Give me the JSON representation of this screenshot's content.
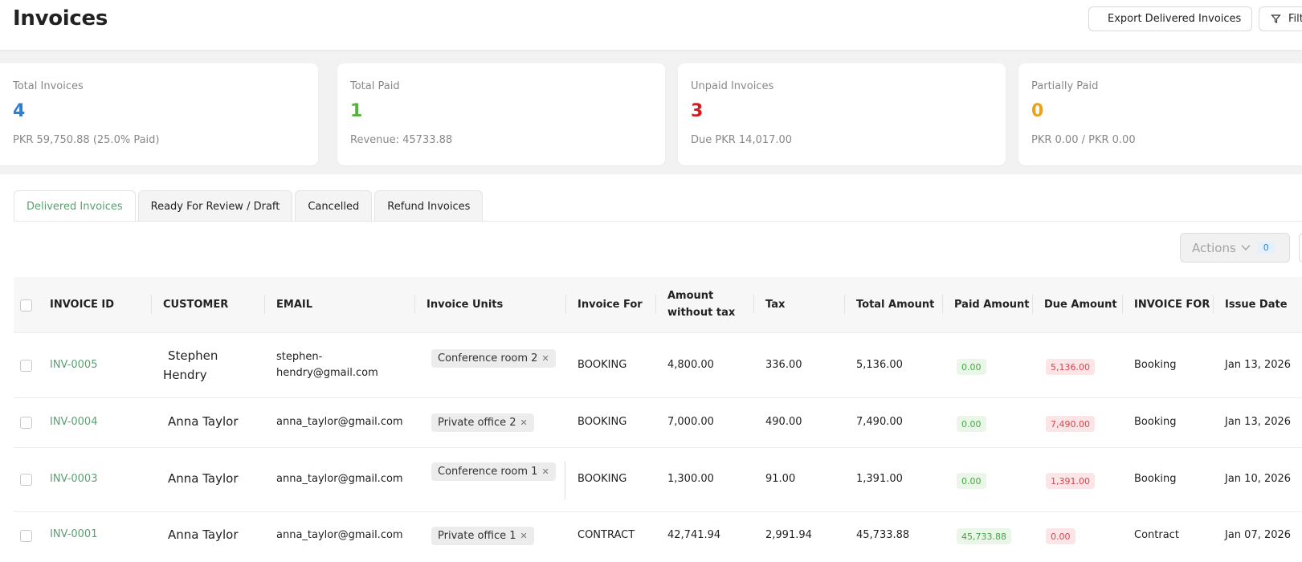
{
  "header": {
    "title": "Invoices",
    "export_label": "Export Delivered Invoices",
    "filter_label": "Filters"
  },
  "cards": [
    {
      "label": "Total Invoices",
      "value": "4",
      "sub": "PKR 59,750.88 (25.0% Paid)",
      "color": "#2b7fd6"
    },
    {
      "label": "Total Paid",
      "value": "1",
      "sub": "Revenue: 45733.88",
      "color": "#52b43a"
    },
    {
      "label": "Unpaid Invoices",
      "value": "3",
      "sub": "Due PKR 14,017.00",
      "color": "#d51b22"
    },
    {
      "label": "Partially Paid",
      "value": "0",
      "sub": "PKR 0.00 / PKR 0.00",
      "color": "#eaa21a"
    }
  ],
  "tabs": [
    {
      "label": "Delivered Invoices",
      "active": true
    },
    {
      "label": "Ready For Review / Draft",
      "active": false
    },
    {
      "label": "Cancelled",
      "active": false
    },
    {
      "label": "Refund Invoices",
      "active": false
    }
  ],
  "actions": {
    "label": "Actions",
    "count": "0"
  },
  "table": {
    "columns": {
      "invoice_id": "INVOICE ID",
      "customer": "CUSTOMER",
      "email": "EMAIL",
      "units": "Invoice Units",
      "invoice_for": "Invoice For",
      "amount_line1": "Amount",
      "amount_line2": "without tax",
      "tax": "Tax",
      "total": "Total Amount",
      "paid": "Paid Amount",
      "due": "Due Amount",
      "invoice_for_2": "INVOICE FOR",
      "issue_date": "Issue Date"
    },
    "rows": [
      {
        "id": "INV-0005",
        "customer_line1": "Stephen",
        "customer_line2": "Hendry",
        "email_line1": "stephen-",
        "email_line2": "hendry@gmail.com",
        "unit": "Conference room 2",
        "invoice_for": "BOOKING",
        "amount": "4,800.00",
        "tax": "336.00",
        "total": "5,136.00",
        "paid": "0.00",
        "due": "5,136.00",
        "invoice_for_2": "Booking",
        "issue_date": "Jan 13, 2026"
      },
      {
        "id": "INV-0004",
        "customer": "Anna Taylor",
        "email": "anna_taylor@gmail.com",
        "unit": "Private office 2",
        "invoice_for": "BOOKING",
        "amount": "7,000.00",
        "tax": "490.00",
        "total": "7,490.00",
        "paid": "0.00",
        "due": "7,490.00",
        "invoice_for_2": "Booking",
        "issue_date": "Jan 13, 2026"
      },
      {
        "id": "INV-0003",
        "customer": "Anna Taylor",
        "email": "anna_taylor@gmail.com",
        "unit": "Conference room 1",
        "invoice_for": "BOOKING",
        "amount": "1,300.00",
        "tax": "91.00",
        "total": "1,391.00",
        "paid": "0.00",
        "due": "1,391.00",
        "invoice_for_2": "Booking",
        "issue_date": "Jan 10, 2026"
      },
      {
        "id": "INV-0001",
        "customer": "Anna Taylor",
        "email": "anna_taylor@gmail.com",
        "unit": "Private office 1",
        "invoice_for": "CONTRACT",
        "amount": "42,741.94",
        "tax": "2,991.94",
        "total": "45,733.88",
        "paid": "45,733.88",
        "due": "0.00",
        "invoice_for_2": "Contract",
        "issue_date": "Jan 07, 2026"
      }
    ]
  }
}
